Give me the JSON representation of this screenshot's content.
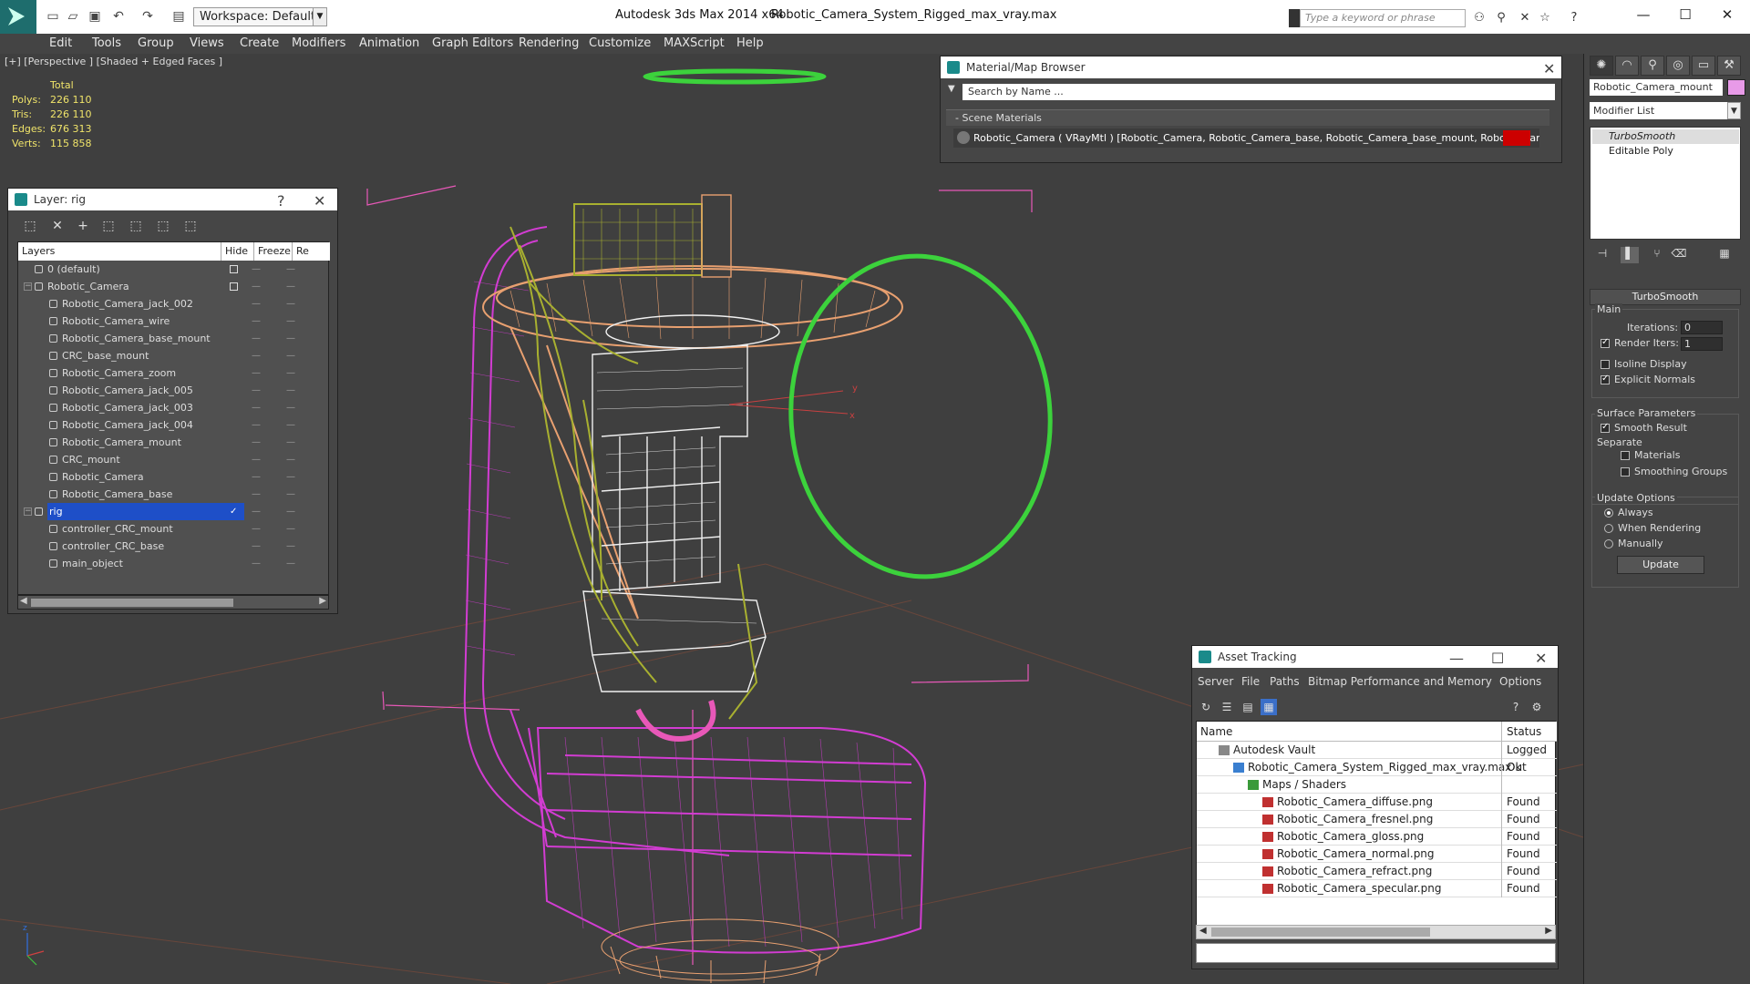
{
  "titlebar": {
    "workspace": "Workspace: Default",
    "app_title": "Autodesk 3ds Max  2014 x64",
    "file_title": "Robotic_Camera_System_Rigged_max_vray.max",
    "search_placeholder": "Type a keyword or phrase"
  },
  "menu": [
    "Edit",
    "Tools",
    "Group",
    "Views",
    "Create",
    "Modifiers",
    "Animation",
    "Graph Editors",
    "Rendering",
    "Customize",
    "MAXScript",
    "Help"
  ],
  "viewport": {
    "label": "[+] [Perspective ] [Shaded + Edged Faces ]",
    "stats": {
      "total": "Total",
      "polys_label": "Polys:",
      "polys": "226 110",
      "tris_label": "Tris:",
      "tris": "226 110",
      "edges_label": "Edges:",
      "edges": "676 313",
      "verts_label": "Verts:",
      "verts": "115 858"
    },
    "axis_x": "x",
    "axis_y": "y",
    "axis_z": "z"
  },
  "layer_panel": {
    "title": "Layer: rig",
    "help": "?",
    "close": "✕",
    "columns": {
      "layers": "Layers",
      "hide": "Hide",
      "freeze": "Freeze",
      "re": "Re"
    },
    "rows": [
      {
        "name": "0 (default)",
        "level": 0
      },
      {
        "name": "Robotic_Camera",
        "level": 0
      },
      {
        "name": "Robotic_Camera_jack_002",
        "level": 1
      },
      {
        "name": "Robotic_Camera_wire",
        "level": 1
      },
      {
        "name": "Robotic_Camera_base_mount",
        "level": 1
      },
      {
        "name": "CRC_base_mount",
        "level": 1
      },
      {
        "name": "Robotic_Camera_zoom",
        "level": 1
      },
      {
        "name": "Robotic_Camera_jack_005",
        "level": 1
      },
      {
        "name": "Robotic_Camera_jack_003",
        "level": 1
      },
      {
        "name": "Robotic_Camera_jack_004",
        "level": 1
      },
      {
        "name": "Robotic_Camera_mount",
        "level": 1
      },
      {
        "name": "CRC_mount",
        "level": 1
      },
      {
        "name": "Robotic_Camera",
        "level": 1
      },
      {
        "name": "Robotic_Camera_base",
        "level": 1
      },
      {
        "name": "rig",
        "level": 0
      },
      {
        "name": "controller_CRC_mount",
        "level": 1
      },
      {
        "name": "controller_CRC_base",
        "level": 1
      },
      {
        "name": "main_object",
        "level": 1
      }
    ],
    "dash": "—",
    "check": "✓"
  },
  "material_browser": {
    "title": "Material/Map Browser",
    "search_placeholder": "Search by Name ...",
    "section": "- Scene Materials",
    "material": "Robotic_Camera ( VRayMtl ) [Robotic_Camera, Robotic_Camera_base, Robotic_Camera_base_mount, Robotic_Camera_j..."
  },
  "asset_tracking": {
    "title": "Asset Tracking",
    "menu": [
      "Server",
      "File",
      "Paths",
      "Bitmap Performance and Memory",
      "Options"
    ],
    "col_name": "Name",
    "col_status": "Status",
    "rows": [
      {
        "name": "Autodesk Vault",
        "status": "Logged Out",
        "indent": 1
      },
      {
        "name": "Robotic_Camera_System_Rigged_max_vray.max",
        "status": "Ok",
        "indent": 2
      },
      {
        "name": "Maps / Shaders",
        "status": "",
        "indent": 3
      },
      {
        "name": "Robotic_Camera_diffuse.png",
        "status": "Found",
        "indent": 4
      },
      {
        "name": "Robotic_Camera_fresnel.png",
        "status": "Found",
        "indent": 4
      },
      {
        "name": "Robotic_Camera_gloss.png",
        "status": "Found",
        "indent": 4
      },
      {
        "name": "Robotic_Camera_normal.png",
        "status": "Found",
        "indent": 4
      },
      {
        "name": "Robotic_Camera_refract.png",
        "status": "Found",
        "indent": 4
      },
      {
        "name": "Robotic_Camera_specular.png",
        "status": "Found",
        "indent": 4
      }
    ]
  },
  "command_panel": {
    "object_name": "Robotic_Camera_mount",
    "modifier_list": "Modifier List",
    "stack": [
      "TurboSmooth",
      "Editable Poly"
    ],
    "rollout": "TurboSmooth",
    "main": "Main",
    "iterations_label": "Iterations:",
    "iterations": "0",
    "render_iters_label": "Render Iters:",
    "render_iters": "1",
    "isoline": "Isoline Display",
    "explicit_normals": "Explicit Normals",
    "surface_params": "Surface Parameters",
    "smooth_result": "Smooth Result",
    "separate": "Separate",
    "materials": "Materials",
    "smoothing_groups": "Smoothing Groups",
    "update_options": "Update Options",
    "always": "Always",
    "when_rendering": "When Rendering",
    "manually": "Manually",
    "update_button": "Update"
  },
  "colors": {
    "wire_magenta": "#d23cd2",
    "wire_orange": "#e8a070",
    "wire_white": "#f0f0f0",
    "wire_olive": "#a8b030",
    "controller_green": "#3cd23c",
    "selection": "#1e4fc8"
  }
}
